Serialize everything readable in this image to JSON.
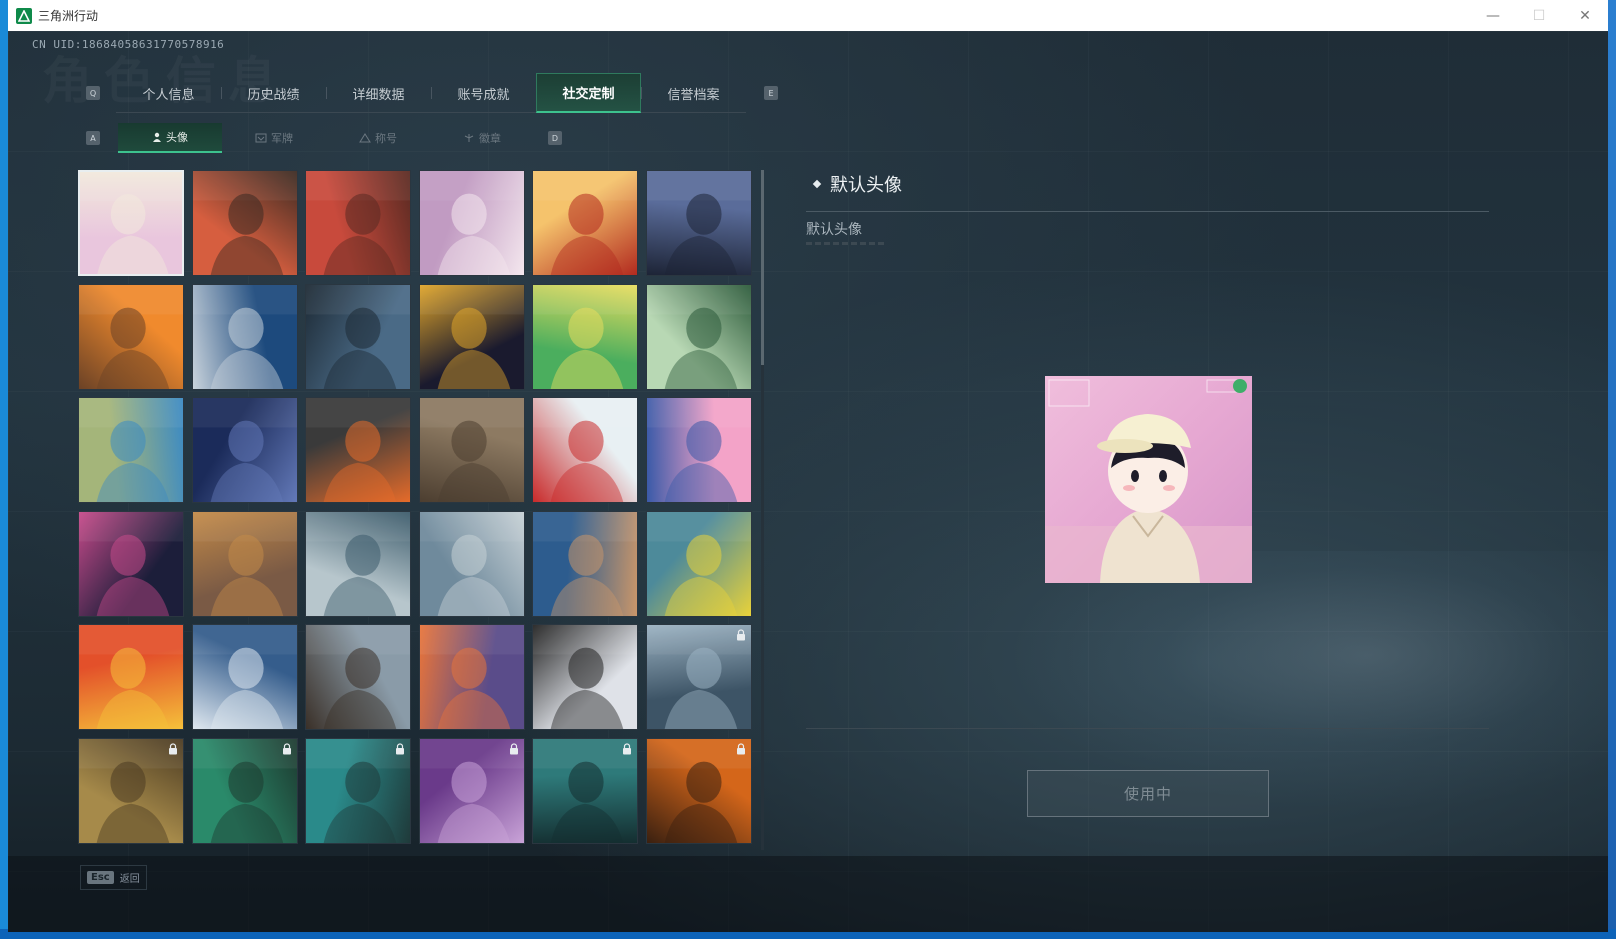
{
  "window": {
    "title": "三角洲行动",
    "minimize": "—",
    "maximize": "☐",
    "close": "✕"
  },
  "uid": "CN UID:18684058631770578916",
  "page_heading_bg": "角色信息",
  "main_tabs": {
    "left_key": "Q",
    "right_key": "E",
    "items": [
      {
        "label": "个人信息"
      },
      {
        "label": "历史战绩"
      },
      {
        "label": "详细数据"
      },
      {
        "label": "账号成就"
      },
      {
        "label": "社交定制",
        "active": true
      },
      {
        "label": "信誉档案"
      }
    ]
  },
  "sub_tabs": {
    "left_key": "A",
    "right_key": "D",
    "items": [
      {
        "label": "头像",
        "icon": "person-icon",
        "active": true
      },
      {
        "label": "军牌",
        "icon": "badge-icon"
      },
      {
        "label": "称号",
        "icon": "title-icon"
      },
      {
        "label": "徽章",
        "icon": "emblem-icon"
      }
    ]
  },
  "avatars": [
    {
      "name": "default-cartoon-boy",
      "locked": false,
      "selected": true,
      "colors": [
        "#e9c6dd",
        "#f2e9dc"
      ]
    },
    {
      "name": "bearded-cap-soldier",
      "locked": false,
      "colors": [
        "#d65e3f",
        "#3b2a22"
      ]
    },
    {
      "name": "helmet-soldier-red",
      "locked": false,
      "colors": [
        "#c84a3c",
        "#5a2a22"
      ]
    },
    {
      "name": "white-hair-girl",
      "locked": false,
      "colors": [
        "#c19bc2",
        "#f4e7ee"
      ]
    },
    {
      "name": "red-bean-soup",
      "locked": false,
      "colors": [
        "#f5c36c",
        "#b22a1f"
      ]
    },
    {
      "name": "night-gunner",
      "locked": false,
      "colors": [
        "#5a6c9a",
        "#1d2436"
      ]
    },
    {
      "name": "muscle-operator-orange",
      "locked": false,
      "colors": [
        "#f08a2d",
        "#6b4226"
      ]
    },
    {
      "name": "glasses-agent",
      "locked": false,
      "colors": [
        "#1d4a7d",
        "#c9d3dc"
      ]
    },
    {
      "name": "sniper-scope",
      "locked": false,
      "colors": [
        "#4a6a86",
        "#1d2a35"
      ]
    },
    {
      "name": "map-book-dark",
      "locked": false,
      "colors": [
        "#1a1a2e",
        "#e0a52a"
      ]
    },
    {
      "name": "exit-door-green",
      "locked": false,
      "colors": [
        "#4bae5e",
        "#e8dd5f"
      ]
    },
    {
      "name": "way-out-sign",
      "locked": false,
      "colors": [
        "#b8d8b4",
        "#2c5a3a"
      ]
    },
    {
      "name": "blue-vase",
      "locked": false,
      "colors": [
        "#a4b57a",
        "#3b8ac4"
      ]
    },
    {
      "name": "starry-soldiers",
      "locked": false,
      "colors": [
        "#1b2b5a",
        "#6379b8"
      ]
    },
    {
      "name": "feather-pattern",
      "locked": false,
      "colors": [
        "#3a3a3a",
        "#e56b2a"
      ]
    },
    {
      "name": "rusty-car-desert",
      "locked": false,
      "colors": [
        "#8d7a62",
        "#4c3e30"
      ]
    },
    {
      "name": "snowman-2025",
      "locked": false,
      "colors": [
        "#e8f0f3",
        "#c92a2a"
      ]
    },
    {
      "name": "chibi-girl-goggles",
      "locked": false,
      "colors": [
        "#f3a3c8",
        "#3a5aa8"
      ]
    },
    {
      "name": "fireworks-night",
      "locked": false,
      "colors": [
        "#1c1e3a",
        "#c64a8a"
      ]
    },
    {
      "name": "scales-emblem",
      "locked": false,
      "colors": [
        "#7a5a45",
        "#c38a48"
      ]
    },
    {
      "name": "wave-dragon",
      "locked": false,
      "colors": [
        "#b7c6cc",
        "#3c5b6b"
      ]
    },
    {
      "name": "mountain-climber",
      "locked": false,
      "colors": [
        "#6f8a9c",
        "#c7d1d6"
      ]
    },
    {
      "name": "archer-girl",
      "locked": false,
      "colors": [
        "#2d5c8e",
        "#c9966a"
      ]
    },
    {
      "name": "alligator-sign",
      "locked": false,
      "colors": [
        "#4d8a9a",
        "#e8d23a"
      ]
    },
    {
      "name": "explosion-hand",
      "locked": false,
      "colors": [
        "#e3502a",
        "#f5c03a"
      ]
    },
    {
      "name": "arctic-soldier",
      "locked": false,
      "colors": [
        "#355d8c",
        "#dfe8f0"
      ]
    },
    {
      "name": "city-skyline-soldier",
      "locked": false,
      "colors": [
        "#8a9ba8",
        "#3a3028"
      ]
    },
    {
      "name": "snow-cabin-moon",
      "locked": false,
      "colors": [
        "#5a4c8a",
        "#e8743a"
      ]
    },
    {
      "name": "calligraphy-art",
      "locked": false,
      "colors": [
        "#dfe2e8",
        "#222222"
      ]
    },
    {
      "name": "pilot-portrait",
      "locked": true,
      "colors": [
        "#3d5466",
        "#9bb2c2"
      ]
    },
    {
      "name": "bearded-headset",
      "locked": true,
      "colors": [
        "#a68a4a",
        "#4a3a22"
      ]
    },
    {
      "name": "green-headphones-man",
      "locked": true,
      "colors": [
        "#2a8a6a",
        "#1d3a30"
      ]
    },
    {
      "name": "glasses-beard-teal",
      "locked": true,
      "colors": [
        "#2a8a8a",
        "#1f3a3a"
      ]
    },
    {
      "name": "purple-helmet-girl",
      "locked": true,
      "colors": [
        "#6a3a8a",
        "#c9a3d8"
      ]
    },
    {
      "name": "armored-teal",
      "locked": true,
      "colors": [
        "#2e7a7a",
        "#142e30"
      ]
    },
    {
      "name": "masked-orange",
      "locked": true,
      "colors": [
        "#d4661a",
        "#3a2010"
      ]
    }
  ],
  "detail": {
    "heading": "默认头像",
    "subheading": "默认头像",
    "button_label": "使用中"
  },
  "footer": {
    "esc_key": "Esc",
    "back_label": "返回"
  },
  "colors": {
    "accent_green": "#3dc28e",
    "active_tab_bg": "#245244",
    "panel_bg": "#1f2d37"
  }
}
